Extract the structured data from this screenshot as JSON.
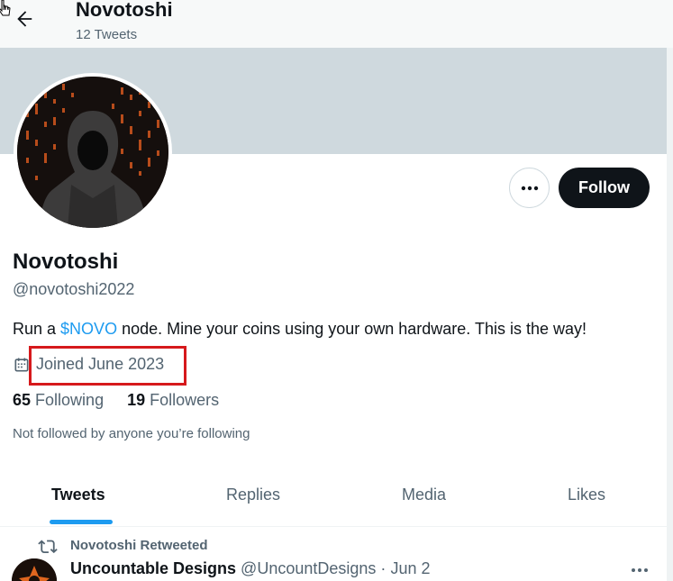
{
  "header": {
    "title": "Novotoshi",
    "tweet_count": "12 Tweets",
    "back_icon": "back-arrow-icon"
  },
  "profile": {
    "display_name": "Novotoshi",
    "handle": "@novotoshi2022",
    "bio_prefix": "Run a ",
    "bio_link": "$NOVO",
    "bio_suffix": " node. Mine your coins using your own hardware. This is the way!",
    "joined": "Joined June 2023",
    "following_count": "65",
    "following_label": "Following",
    "followers_count": "19",
    "followers_label": "Followers",
    "not_followed": "Not followed by anyone you’re following"
  },
  "actions": {
    "follow_label": "Follow",
    "more_icon": "more-dots-icon"
  },
  "tabs": [
    {
      "label": "Tweets",
      "active": true
    },
    {
      "label": "Replies",
      "active": false
    },
    {
      "label": "Media",
      "active": false
    },
    {
      "label": "Likes",
      "active": false
    }
  ],
  "tweet": {
    "retweet_label": "Novotoshi Retweeted",
    "author_name": "Uncountable Designs",
    "author_handle": "@UncountDesigns",
    "separator": "·",
    "date": "Jun 2"
  },
  "colors": {
    "accent": "#1d9bf0",
    "highlight": "#d6191c",
    "banner": "#cfd9de",
    "text_secondary": "#536471"
  }
}
